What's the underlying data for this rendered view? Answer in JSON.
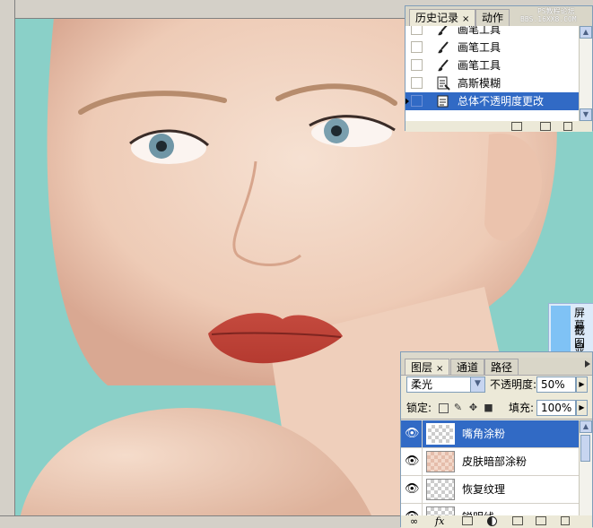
{
  "colors": {
    "background": "#8ad0c8",
    "selection": "#316ac5",
    "panel": "#ece9d8"
  },
  "watermark": {
    "line1": "PS教程论坛",
    "line2": "BBS.16XX8.COM"
  },
  "history_panel": {
    "tabs": [
      {
        "label": "历史记录",
        "close": "×",
        "active": true
      },
      {
        "label": "动作",
        "active": false
      }
    ],
    "rows": [
      {
        "label": "画笔工具",
        "icon": "brush-icon",
        "selected": false
      },
      {
        "label": "画笔工具",
        "icon": "brush-icon",
        "selected": false
      },
      {
        "label": "画笔工具",
        "icon": "brush-icon",
        "selected": false
      },
      {
        "label": "高斯模糊",
        "icon": "filter-document-icon",
        "selected": false
      },
      {
        "label": "总体不透明度更改",
        "icon": "layer-properties-icon",
        "selected": true
      }
    ],
    "footer_icons": [
      "new-document-from-state-icon",
      "new-snapshot-icon",
      "trash-icon"
    ]
  },
  "side_panel": {
    "items": [
      "屏幕",
      "截图",
      "显示"
    ]
  },
  "layers_panel": {
    "tabs": [
      {
        "label": "图层",
        "close": "×",
        "active": true
      },
      {
        "label": "通道",
        "active": false
      },
      {
        "label": "路径",
        "active": false
      }
    ],
    "blend_mode": "柔光",
    "opacity_label": "不透明度:",
    "opacity_value": "50%",
    "lock_label": "锁定:",
    "fill_label": "填充:",
    "fill_value": "100%",
    "layers": [
      {
        "name": "嘴角涂粉",
        "visible": true,
        "selected": true,
        "thumb": "transparent"
      },
      {
        "name": "皮肤暗部涂粉",
        "visible": true,
        "selected": false,
        "thumb": "skin-tint"
      },
      {
        "name": "恢复纹理",
        "visible": true,
        "selected": false,
        "thumb": "transparent"
      },
      {
        "name": "锐明线",
        "visible": true,
        "selected": false,
        "thumb": "transparent"
      }
    ],
    "footer_icons": [
      "link-layers-icon",
      "fx-icon",
      "add-mask-icon",
      "adjustment-layer-icon",
      "new-group-icon",
      "new-layer-icon",
      "trash-icon"
    ]
  }
}
